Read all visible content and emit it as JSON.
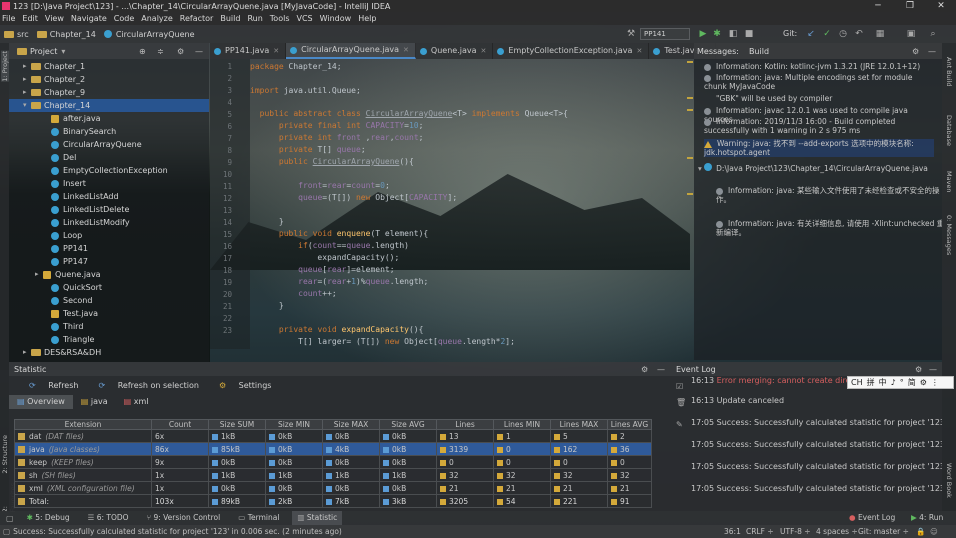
{
  "window": {
    "title": "123 [D:\\Java Project\\123] - ...\\Chapter_14\\CircularArrayQuene.java [MyJavaCode] - IntelliJ IDEA",
    "minimize": "─",
    "maximize": "❐",
    "close": "✕"
  },
  "menu": [
    "File",
    "Edit",
    "View",
    "Navigate",
    "Code",
    "Analyze",
    "Refactor",
    "Build",
    "Run",
    "Tools",
    "VCS",
    "Window",
    "Help"
  ],
  "navbar": {
    "crumbs": [
      "src",
      "Chapter_14",
      "CircularArrayQuene"
    ],
    "run_config": "PP141",
    "git_label": "Git:"
  },
  "project": {
    "header": "Project",
    "items": [
      {
        "label": "Chapter_1",
        "type": "folder",
        "depth": 0,
        "expanded": false
      },
      {
        "label": "Chapter_2",
        "type": "folder",
        "depth": 0,
        "expanded": false
      },
      {
        "label": "Chapter_9",
        "type": "folder",
        "depth": 0,
        "expanded": false
      },
      {
        "label": "Chapter_14",
        "type": "folder",
        "depth": 0,
        "expanded": true,
        "selected": true
      },
      {
        "label": "after.java",
        "type": "file",
        "depth": 1
      },
      {
        "label": "BinarySearch",
        "type": "class",
        "depth": 1
      },
      {
        "label": "CircularArrayQuene",
        "type": "class",
        "depth": 1
      },
      {
        "label": "Del",
        "type": "class",
        "depth": 1
      },
      {
        "label": "EmptyCollectionException",
        "type": "class",
        "depth": 1
      },
      {
        "label": "Insert",
        "type": "class",
        "depth": 1
      },
      {
        "label": "LinkedListAdd",
        "type": "class",
        "depth": 1
      },
      {
        "label": "LinkedListDelete",
        "type": "class",
        "depth": 1
      },
      {
        "label": "LinkedListModify",
        "type": "class",
        "depth": 1
      },
      {
        "label": "Loop",
        "type": "class",
        "depth": 1
      },
      {
        "label": "PP141",
        "type": "class",
        "depth": 1
      },
      {
        "label": "PP147",
        "type": "class",
        "depth": 1
      },
      {
        "label": "Quene.java",
        "type": "file",
        "depth": 1,
        "expandable": true
      },
      {
        "label": "QuickSort",
        "type": "class",
        "depth": 1
      },
      {
        "label": "Second",
        "type": "class",
        "depth": 1
      },
      {
        "label": "Test.java",
        "type": "file",
        "depth": 1
      },
      {
        "label": "Third",
        "type": "class",
        "depth": 1
      },
      {
        "label": "Triangle",
        "type": "class",
        "depth": 1
      },
      {
        "label": "DES&RSA&DH",
        "type": "folder",
        "depth": 0,
        "expanded": false
      }
    ]
  },
  "editor_tabs": [
    {
      "label": "PP141.java",
      "active": false
    },
    {
      "label": "CircularArrayQuene.java",
      "active": true
    },
    {
      "label": "Quene.java",
      "active": false
    },
    {
      "label": "EmptyCollectionException.java",
      "active": false
    },
    {
      "label": "Test.java",
      "active": false
    }
  ],
  "editor": {
    "line_numbers": [
      "1",
      "2",
      "3",
      "4",
      "5",
      "6",
      "7",
      "8",
      "9",
      "10",
      "11",
      "12",
      "13",
      "14",
      "15",
      "16",
      "17",
      "18",
      "19",
      "20",
      "21",
      "22",
      "23"
    ]
  },
  "messages": {
    "header_tab": "Messages:",
    "header_sub": "Build",
    "items": [
      {
        "kind": "info",
        "text": "Information: Kotlin: kotlinc-jvm 1.3.21 (JRE 12.0.1+12)"
      },
      {
        "kind": "info",
        "text": "Information: java: Multiple encodings set for module chunk MyJavaCode"
      },
      {
        "kind": "info",
        "text": "\"GBK\" will be used by compiler"
      },
      {
        "kind": "info",
        "text": "Information: javac 12.0.1 was used to compile java sources"
      },
      {
        "kind": "info",
        "text": "Information: 2019/11/3 16:00 - Build completed successfully with 1 warning in 2 s 975 ms"
      },
      {
        "kind": "warn",
        "text": "Warning: java: 找不到 --add-exports 选项中的模块名称: jdk.hotspot.agent"
      },
      {
        "kind": "file",
        "text": "D:\\Java Project\\123\\Chapter_14\\CircularArrayQuene.java"
      },
      {
        "kind": "info",
        "text": "Information: java: 某些输入文件使用了未经检查或不安全的操作。"
      },
      {
        "kind": "info",
        "text": "Information: java: 有关详细信息, 请使用 -Xlint:unchecked 重新编译。"
      }
    ]
  },
  "statistic": {
    "header": "Statistic",
    "refresh": "Refresh",
    "refresh_on_selection": "Refresh on selection",
    "settings": "Settings",
    "tabs": [
      "Overview",
      "java",
      "xml"
    ],
    "columns": [
      "Extension",
      "Count",
      "Size SUM",
      "Size MIN",
      "Size MAX",
      "Size AVG",
      "Lines",
      "Lines MIN",
      "Lines MAX",
      "Lines AVG"
    ],
    "rows": [
      {
        "ext": "dat",
        "desc": "(DAT files)",
        "count": "6x",
        "sum": "1kB",
        "min": "0kB",
        "max": "0kB",
        "avg": "0kB",
        "lines": "13",
        "lmin": "1",
        "lmax": "5",
        "lavg": "2"
      },
      {
        "ext": "java",
        "desc": "(Java classes)",
        "count": "86x",
        "sum": "85kB",
        "min": "0kB",
        "max": "4kB",
        "avg": "0kB",
        "lines": "3139",
        "lmin": "0",
        "lmax": "162",
        "lavg": "36",
        "selected": true
      },
      {
        "ext": "keep",
        "desc": "(KEEP files)",
        "count": "9x",
        "sum": "0kB",
        "min": "0kB",
        "max": "0kB",
        "avg": "0kB",
        "lines": "0",
        "lmin": "0",
        "lmax": "0",
        "lavg": "0"
      },
      {
        "ext": "sh",
        "desc": "(SH files)",
        "count": "1x",
        "sum": "1kB",
        "min": "1kB",
        "max": "1kB",
        "avg": "1kB",
        "lines": "32",
        "lmin": "32",
        "lmax": "32",
        "lavg": "32"
      },
      {
        "ext": "xml",
        "desc": "(XML configuration file)",
        "count": "1x",
        "sum": "0kB",
        "min": "0kB",
        "max": "0kB",
        "avg": "0kB",
        "lines": "21",
        "lmin": "21",
        "lmax": "21",
        "lavg": "21"
      },
      {
        "ext": "Total:",
        "desc": "",
        "count": "103x",
        "sum": "89kB",
        "min": "2kB",
        "max": "7kB",
        "avg": "3kB",
        "lines": "3205",
        "lmin": "54",
        "lmax": "221",
        "lavg": "91",
        "total": true
      }
    ]
  },
  "event_log": {
    "header": "Event Log",
    "lines": [
      {
        "time": "16:13",
        "text": "Error merging: cannot create direct",
        "error": true
      },
      {
        "time": "16:13",
        "text": "Update canceled"
      },
      {
        "time": "17:05",
        "text": "Success: Successfully calculated statistic for project '123' in 0.0"
      },
      {
        "time": "17:05",
        "text": "Success: Successfully calculated statistic for project '123' in 0.0"
      },
      {
        "time": "17:05",
        "text": "Success: Successfully calculated statistic for project '123' in 0.0"
      },
      {
        "time": "17:05",
        "text": "Success: Successfully calculated statistic for project '123' in 0.0"
      }
    ]
  },
  "ime": [
    "CH",
    "拼",
    "中",
    "♪",
    "°",
    "简",
    "⚙",
    "⋮"
  ],
  "bottom_tabs": [
    {
      "label": "5: Debug",
      "active": false
    },
    {
      "label": "6: TODO",
      "active": false
    },
    {
      "label": "9: Version Control",
      "active": false
    },
    {
      "label": "Terminal",
      "active": false
    },
    {
      "label": "Statistic",
      "active": true
    }
  ],
  "bottom_right_tabs": [
    "Event Log",
    "4: Run"
  ],
  "status": {
    "message": "Success: Successfully calculated statistic for project '123' in 0.006 sec. (2 minutes ago)",
    "position": "36:1",
    "line_sep": "CRLF ÷",
    "encoding": "UTF-8 ÷",
    "indent": "4 spaces ÷",
    "git": "Git: master ÷"
  },
  "left_stripe": [
    "1: Project",
    "2: Structure",
    "2: Favorites"
  ],
  "right_stripe": [
    "Ant Build",
    "Database",
    "Maven",
    "0: Messages",
    "Word Book"
  ],
  "colors": {
    "accent": "#4a88c7",
    "selection": "#2f5a9a",
    "error": "#d65f5f",
    "warning": "#d4a93a"
  }
}
